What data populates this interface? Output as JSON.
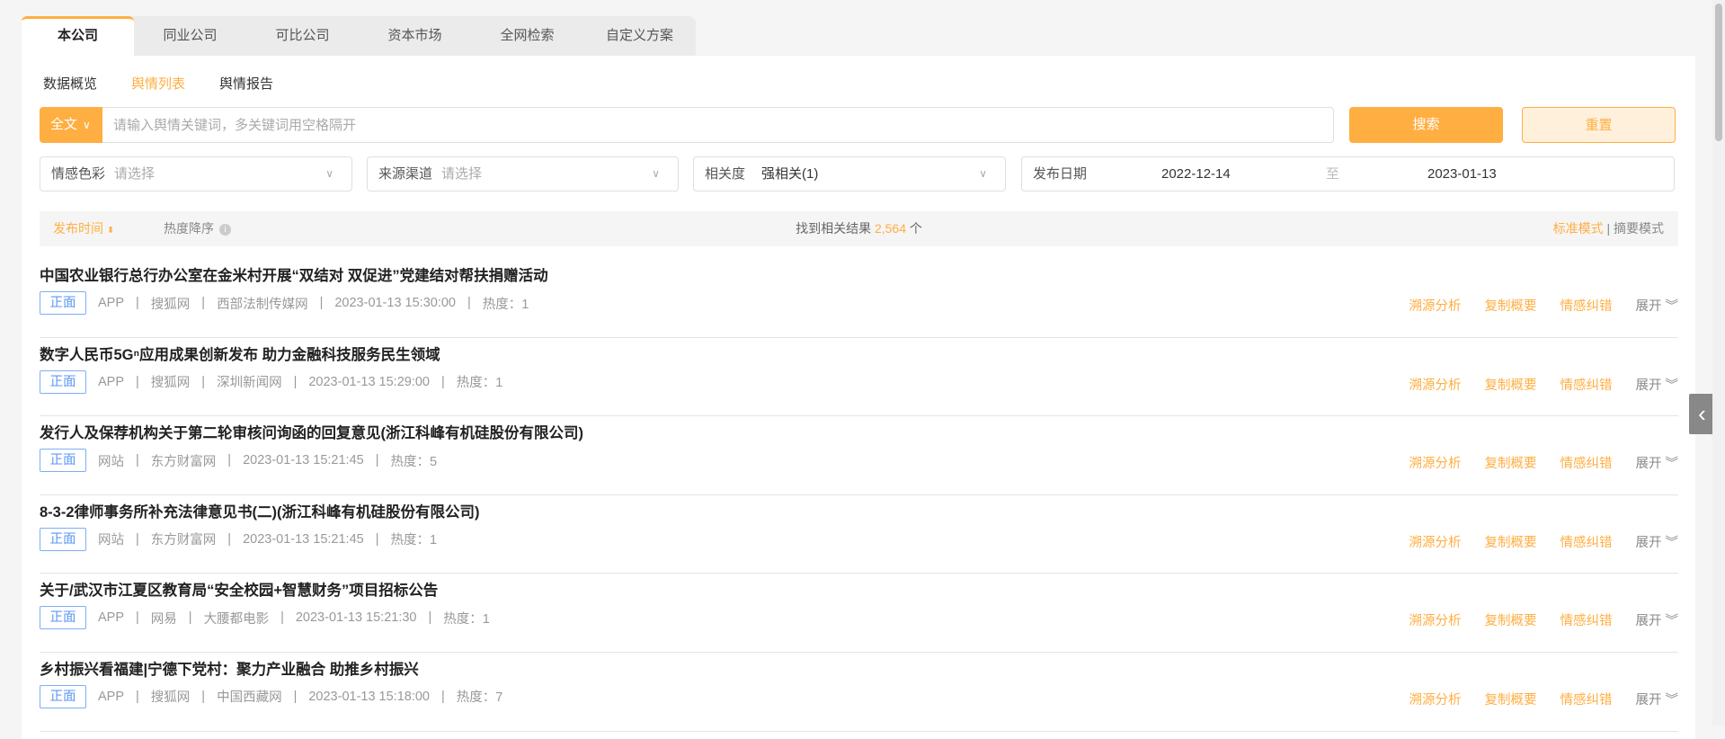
{
  "tabs": [
    "本公司",
    "同业公司",
    "可比公司",
    "资本市场",
    "全网检索",
    "自定义方案"
  ],
  "subtabs": [
    "数据概览",
    "舆情列表",
    "舆情报告"
  ],
  "search": {
    "scope": "全文",
    "placeholder": "请输入舆情关键词，多关键词用空格隔开",
    "search_label": "搜索",
    "reset_label": "重置"
  },
  "filters": {
    "sentiment": {
      "label": "情感色彩",
      "placeholder": "请选择"
    },
    "source": {
      "label": "来源渠道",
      "placeholder": "请选择"
    },
    "relevance": {
      "label": "相关度",
      "value": "强相关(1)"
    },
    "date": {
      "label": "发布日期",
      "start": "2022-12-14",
      "to": "至",
      "end": "2023-01-13"
    }
  },
  "sortbar": {
    "sort_time": "发布时间",
    "sort_heat": "热度降序",
    "result_prefix": "找到相关结果",
    "result_count": "2,564",
    "result_suffix": "个",
    "mode_standard": "标准模式",
    "mode_sep": "|",
    "mode_summary": "摘要模式"
  },
  "actions": {
    "trace": "溯源分析",
    "copy": "复制概要",
    "correct": "情感纠错",
    "expand": "展开"
  },
  "items": [
    {
      "title": "中国农业银行总行办公室在金米村开展“双结对 双促进”党建结对帮扶捐赠活动",
      "tag": "正面",
      "channel": "APP",
      "platform": "搜狐网",
      "source": "西部法制传媒网",
      "time": "2023-01-13 15:30:00",
      "heat": "热度：1"
    },
    {
      "title": "数字人民币5Gⁿ应用成果创新发布 助力金融科技服务民生领域",
      "tag": "正面",
      "channel": "APP",
      "platform": "搜狐网",
      "source": "深圳新闻网",
      "time": "2023-01-13 15:29:00",
      "heat": "热度：1"
    },
    {
      "title": "发行人及保荐机构关于第二轮审核问询函的回复意见(浙江科峰有机硅股份有限公司)",
      "tag": "正面",
      "channel": "网站",
      "platform": "东方财富网",
      "source": "",
      "time": "2023-01-13 15:21:45",
      "heat": "热度：5"
    },
    {
      "title": "8-3-2律师事务所补充法律意见书(二)(浙江科峰有机硅股份有限公司)",
      "tag": "正面",
      "channel": "网站",
      "platform": "东方财富网",
      "source": "",
      "time": "2023-01-13 15:21:45",
      "heat": "热度：1"
    },
    {
      "title": "关于/武汉市江夏区教育局“安全校园+智慧财务”项目招标公告",
      "tag": "正面",
      "channel": "APP",
      "platform": "网易",
      "source": "大腰都电影",
      "time": "2023-01-13 15:21:30",
      "heat": "热度：1"
    },
    {
      "title": "乡村振兴看福建|宁德下党村：聚力产业融合 助推乡村振兴",
      "tag": "正面",
      "channel": "APP",
      "platform": "搜狐网",
      "source": "中国西藏网",
      "time": "2023-01-13 15:18:00",
      "heat": "热度：7"
    }
  ],
  "colors": {
    "accent": "#ffae42",
    "tag_blue": "#5c97f0"
  }
}
